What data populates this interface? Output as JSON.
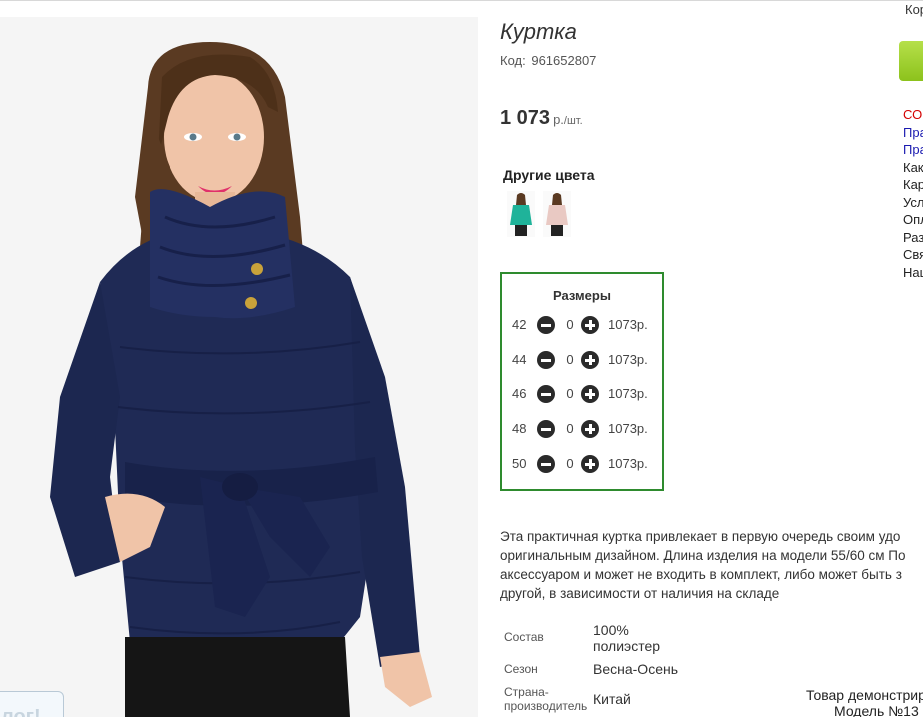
{
  "product": {
    "title": "Куртка",
    "code_label": "Код:",
    "code_value": "961652807",
    "price_value": "1 073",
    "price_unit": "р.",
    "price_per": "/шт."
  },
  "other_colors": {
    "title": "Другие цвета",
    "swatches": [
      {
        "name": "teal-jacket",
        "color": "#1fb39a"
      },
      {
        "name": "pink-jacket",
        "color": "#e9c9c3"
      }
    ]
  },
  "sizes": {
    "title": "Размеры",
    "rows": [
      {
        "size": "42",
        "qty": "0",
        "price": "1073р."
      },
      {
        "size": "44",
        "qty": "0",
        "price": "1073р."
      },
      {
        "size": "46",
        "qty": "0",
        "price": "1073р."
      },
      {
        "size": "48",
        "qty": "0",
        "price": "1073р."
      },
      {
        "size": "50",
        "qty": "0",
        "price": "1073р."
      }
    ]
  },
  "description": {
    "line1": "Эта практичная куртка привлекает в первую очередь своим удо",
    "line2": "оригинальным дизайном. Длина изделия на модели 55/60 см По",
    "line3": "аксессуаром и может не входить в комплект, либо может быть з",
    "line4": "другой, в зависимости от наличия на складе"
  },
  "specs": {
    "composition_label": "Состав",
    "composition_value_1": "100%",
    "composition_value_2": "полиэстер",
    "season_label": "Сезон",
    "season_value": "Весна-Осень",
    "country_label_1": "Страна-",
    "country_label_2": "производитель",
    "country_value": "Китай"
  },
  "demo_note": {
    "line1": "Товар демонстрир",
    "line2": "Модель №13"
  },
  "sidebar": {
    "top_text": "Кор",
    "links": [
      {
        "text": "СО",
        "style": "red"
      },
      {
        "text": "Пра",
        "style": "blue"
      },
      {
        "text": "Пра",
        "style": "blue"
      },
      {
        "text": "Как",
        "style": "dark"
      },
      {
        "text": "Кар",
        "style": "dark"
      },
      {
        "text": "Усл",
        "style": "dark"
      },
      {
        "text": "Опл",
        "style": "dark"
      },
      {
        "text": "Раз",
        "style": "dark"
      },
      {
        "text": "Свя",
        "style": "dark"
      },
      {
        "text": "Наш",
        "style": "dark"
      }
    ]
  },
  "photo_badge": "лог!",
  "colors": {
    "sizes_border": "#2e8b2e",
    "accent_green": "#8cc21c",
    "jacket_navy": "#1f2a55"
  }
}
